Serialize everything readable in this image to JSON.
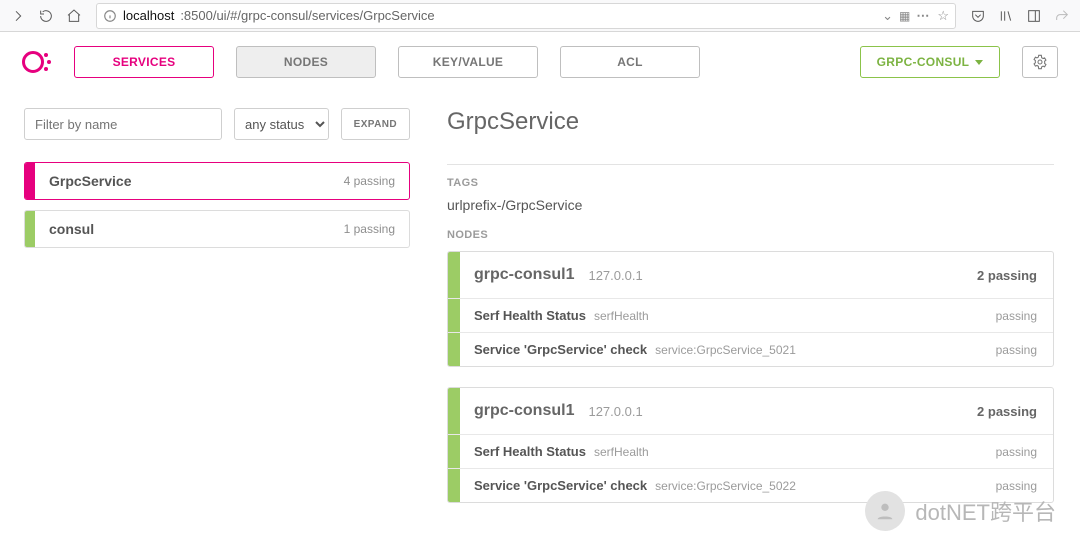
{
  "browser": {
    "url_host": "localhost",
    "url_rest": ":8500/ui/#/grpc-consul/services/GrpcService"
  },
  "nav": {
    "services": "SERVICES",
    "nodes": "NODES",
    "kv": "KEY/VALUE",
    "acl": "ACL",
    "datacenter": "GRPC-CONSUL"
  },
  "filters": {
    "placeholder": "Filter by name",
    "status_selected": "any status",
    "expand": "EXPAND"
  },
  "services": [
    {
      "name": "GrpcService",
      "count": "4 passing",
      "selected": true
    },
    {
      "name": "consul",
      "count": "1 passing",
      "selected": false
    }
  ],
  "detail": {
    "title": "GrpcService",
    "tags_label": "TAGS",
    "tags": "urlprefix-/GrpcService",
    "nodes_label": "NODES",
    "nodes": [
      {
        "name": "grpc-consul1",
        "ip": "127.0.0.1",
        "count": "2 passing",
        "checks": [
          {
            "name": "Serf Health Status",
            "id": "serfHealth",
            "status": "passing"
          },
          {
            "name": "Service 'GrpcService' check",
            "id": "service:GrpcService_5021",
            "status": "passing"
          }
        ]
      },
      {
        "name": "grpc-consul1",
        "ip": "127.0.0.1",
        "count": "2 passing",
        "checks": [
          {
            "name": "Serf Health Status",
            "id": "serfHealth",
            "status": "passing"
          },
          {
            "name": "Service 'GrpcService' check",
            "id": "service:GrpcService_5022",
            "status": "passing"
          }
        ]
      }
    ]
  },
  "watermark": "dotNET跨平台"
}
